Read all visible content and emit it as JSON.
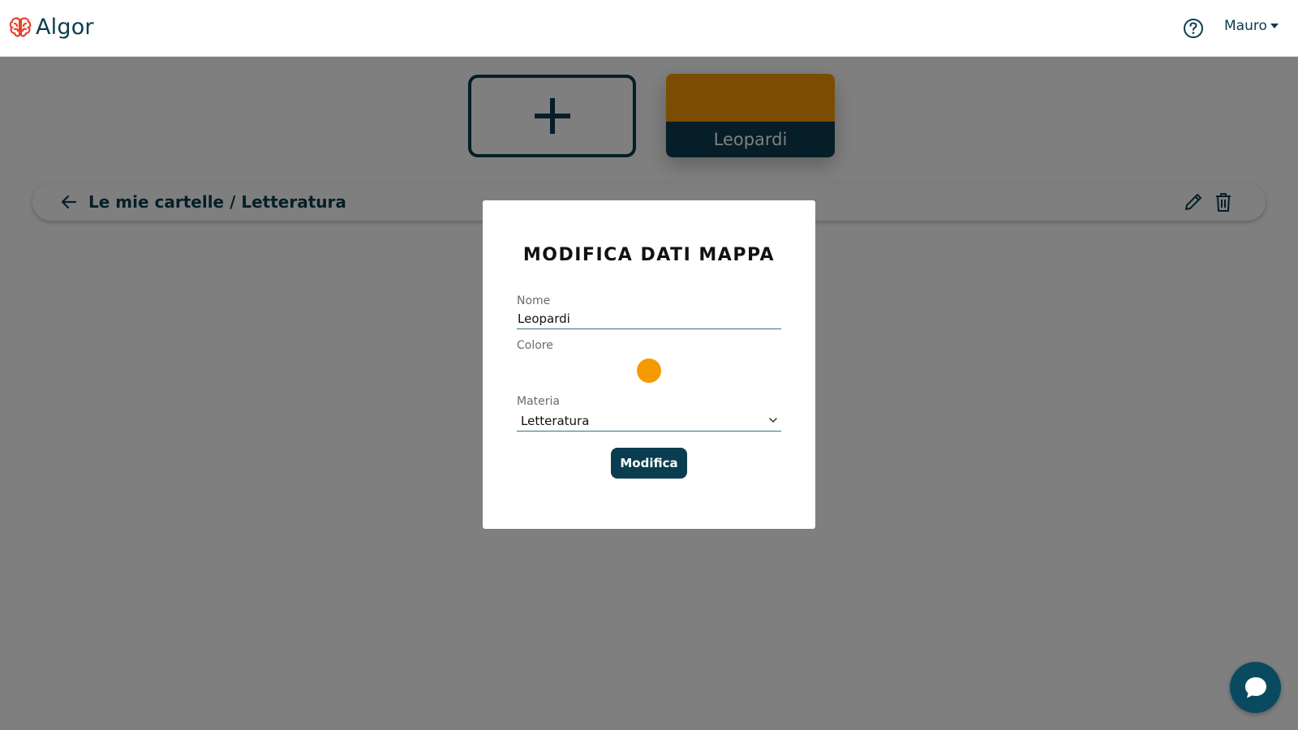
{
  "header": {
    "brand": "Algor",
    "user_name": "Mauro"
  },
  "cards": {
    "map_card_title": "Leopardi",
    "map_card_color": "#f49a00"
  },
  "folder_bar": {
    "breadcrumb": "Le mie cartelle / Letteratura"
  },
  "modal": {
    "title": "MODIFICA DATI MAPPA",
    "name_label": "Nome",
    "name_value": "Leopardi",
    "color_label": "Colore",
    "color_value": "#f49a00",
    "subject_label": "Materia",
    "subject_value": "Letteratura",
    "submit_label": "Modifica"
  },
  "colors": {
    "brand_dark": "#0a3d4f",
    "accent_orange": "#f49a00",
    "logo_red": "#e8432a"
  },
  "icons": {
    "logo": "brain-icon",
    "help": "help-icon",
    "back": "arrow-left-icon",
    "edit": "pencil-icon",
    "delete": "trash-icon",
    "add": "plus-icon",
    "select": "chevron-down-icon",
    "chat": "chat-icon"
  }
}
